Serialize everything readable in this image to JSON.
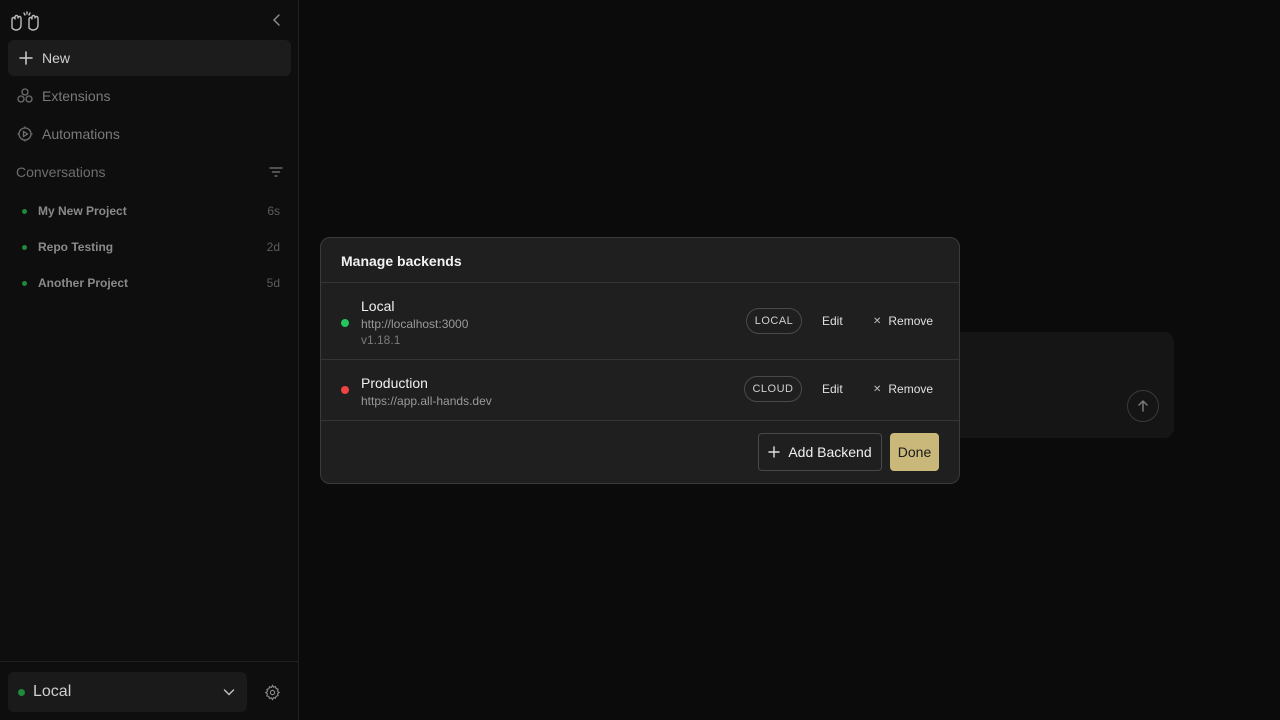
{
  "sidebar": {
    "new_label": "New",
    "nav": [
      {
        "label": "Extensions",
        "icon": "extensions-icon"
      },
      {
        "label": "Automations",
        "icon": "automations-icon"
      }
    ],
    "conversations_title": "Conversations",
    "conversations": [
      {
        "title": "My New Project",
        "age": "6s"
      },
      {
        "title": "Repo Testing",
        "age": "2d"
      },
      {
        "title": "Another Project",
        "age": "5d"
      }
    ],
    "backend_selector": "Local"
  },
  "modal": {
    "title": "Manage backends",
    "backends": [
      {
        "name": "Local",
        "url": "http://localhost:3000",
        "version": "v1.18.1",
        "type": "LOCAL",
        "status_color": "#22c55e"
      },
      {
        "name": "Production",
        "url": "https://app.all-hands.dev",
        "version": "",
        "type": "CLOUD",
        "status_color": "#ef4444"
      }
    ],
    "edit_label": "Edit",
    "remove_label": "Remove",
    "add_label": "Add Backend",
    "done_label": "Done"
  },
  "colors": {
    "accent": "#c9b87a",
    "online": "#22c55e",
    "offline": "#ef4444"
  }
}
